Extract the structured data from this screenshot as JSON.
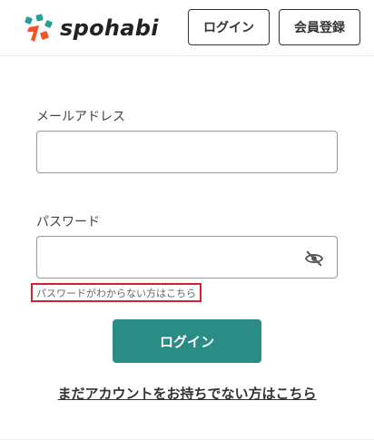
{
  "header": {
    "logo_text": "spohabi",
    "login_label": "ログイン",
    "register_label": "会員登録"
  },
  "form": {
    "email_label": "メールアドレス",
    "email_value": "",
    "password_label": "パスワード",
    "password_value": "",
    "password_toggle_icon": "eye-off-icon",
    "forgot_link": "パスワードがわからない方はこちら",
    "submit_label": "ログイン"
  },
  "signup_link": "まだアカウントをお持ちでない方はこちら",
  "colors": {
    "accent": "#2b8b85",
    "highlight": "#d0232a",
    "logo_orange": "#f0542c",
    "logo_teal": "#2a9d96"
  }
}
